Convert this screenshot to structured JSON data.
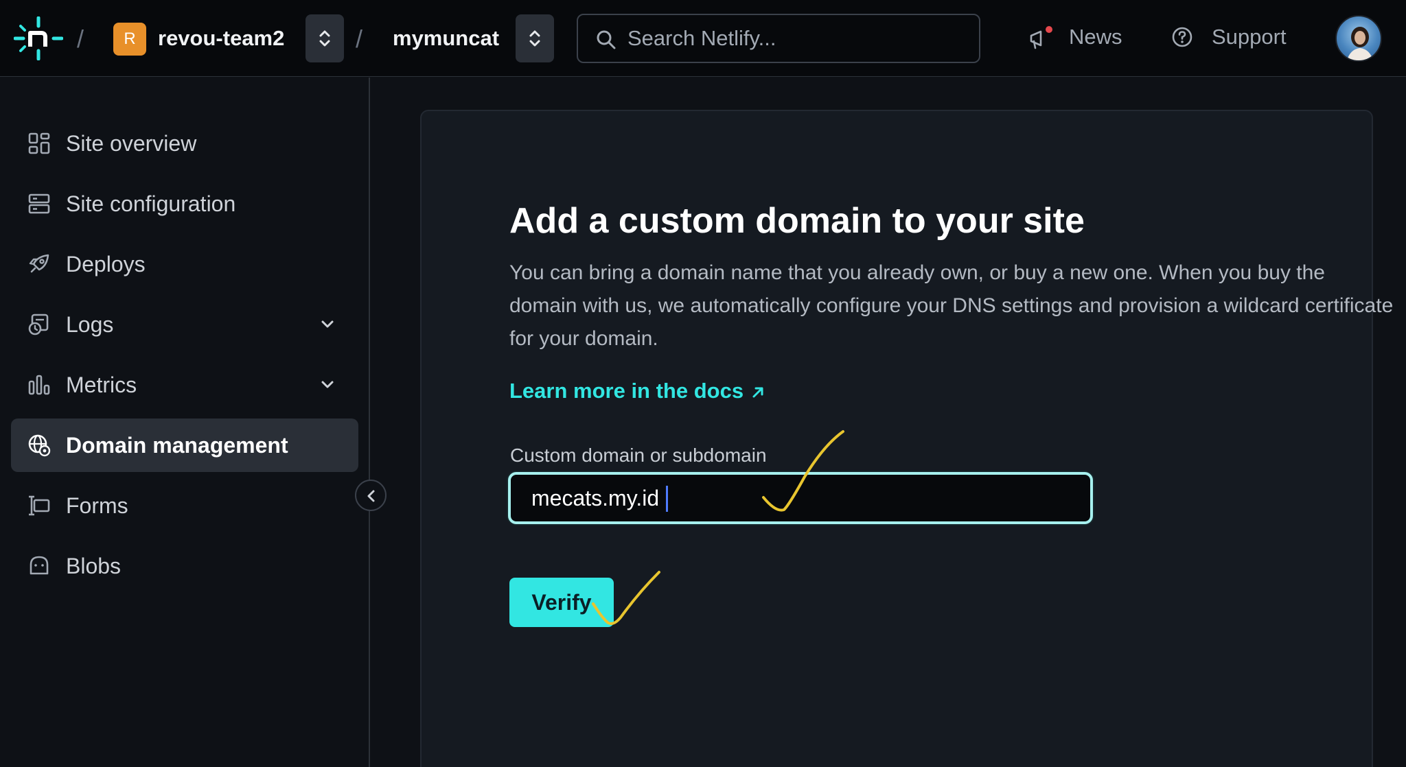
{
  "header": {
    "team_initial": "R",
    "team_name": "revou-team2",
    "separator": "/",
    "site_name": "mymuncat",
    "search_placeholder": "Search Netlify...",
    "news_label": "News",
    "support_label": "Support"
  },
  "sidebar": {
    "items": [
      {
        "label": "Site overview",
        "icon": "overview-grid-icon"
      },
      {
        "label": "Site configuration",
        "icon": "config-server-icon"
      },
      {
        "label": "Deploys",
        "icon": "rocket-icon"
      },
      {
        "label": "Logs",
        "icon": "logs-icon",
        "expandable": true
      },
      {
        "label": "Metrics",
        "icon": "bar-chart-icon",
        "expandable": true
      },
      {
        "label": "Domain management",
        "icon": "globe-gear-icon",
        "active": true
      },
      {
        "label": "Forms",
        "icon": "form-icon"
      },
      {
        "label": "Blobs",
        "icon": "blob-icon"
      }
    ]
  },
  "main": {
    "title": "Add a custom domain to your site",
    "description": "You can bring a domain name that you already own, or buy a new one. When you buy the domain with us, we automatically configure your DNS settings and provision a wildcard certificate for your domain.",
    "docs_link": "Learn more in the docs",
    "field_label": "Custom domain or subdomain",
    "field_value": "mecats.my.id",
    "verify_label": "Verify"
  },
  "colors": {
    "accent": "#32e6e2",
    "background": "#0e1116",
    "card": "#151a21",
    "annotation": "#e8c52f",
    "team_badge": "#e8902a"
  }
}
